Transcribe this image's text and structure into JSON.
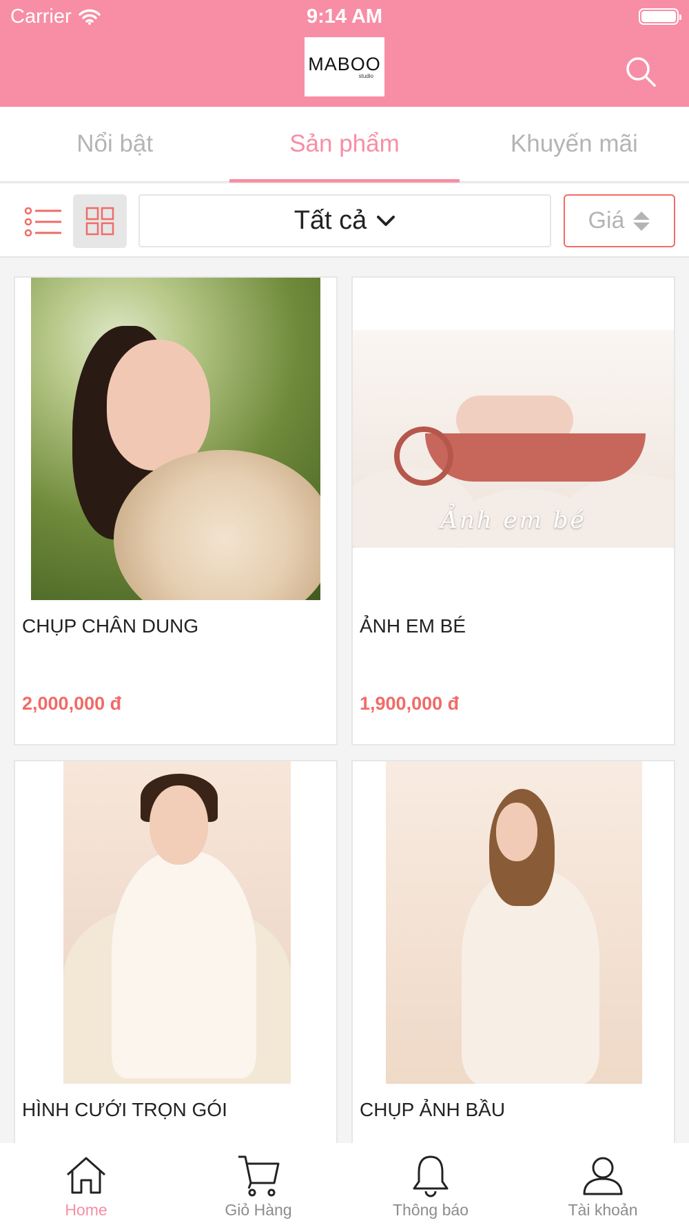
{
  "status_bar": {
    "carrier": "Carrier",
    "time": "9:14 AM"
  },
  "header": {
    "logo_text": "MABOO",
    "logo_sub": "studio",
    "search_icon": "search-icon"
  },
  "tabs": [
    {
      "label": "Nổi bật",
      "active": false
    },
    {
      "label": "Sản phẩm",
      "active": true
    },
    {
      "label": "Khuyến mãi",
      "active": false
    }
  ],
  "filter": {
    "list_view_icon": "list-icon",
    "grid_view_icon": "grid-icon",
    "category": "Tất cả",
    "price_sort_label": "Giá"
  },
  "products": [
    {
      "name": "CHỤP CHÂN DUNG",
      "price": "2,000,000 đ"
    },
    {
      "name": "ẢNH EM BÉ",
      "price": "1,900,000 đ",
      "image_caption": "Ảnh em bé"
    },
    {
      "name": "HÌNH CƯỚI TRỌN GÓI",
      "price": ""
    },
    {
      "name": "CHỤP ẢNH BẦU",
      "price": ""
    }
  ],
  "bottom_nav": [
    {
      "label": "Home",
      "icon": "home-icon",
      "active": true
    },
    {
      "label": "Giỏ Hàng",
      "icon": "cart-icon",
      "active": false
    },
    {
      "label": "Thông báo",
      "icon": "bell-icon",
      "active": false
    },
    {
      "label": "Tài khoản",
      "icon": "user-icon",
      "active": false
    }
  ],
  "colors": {
    "brand_pink": "#f78ea5",
    "price_red": "#f06b67",
    "inactive_gray": "#b4b4b4"
  }
}
